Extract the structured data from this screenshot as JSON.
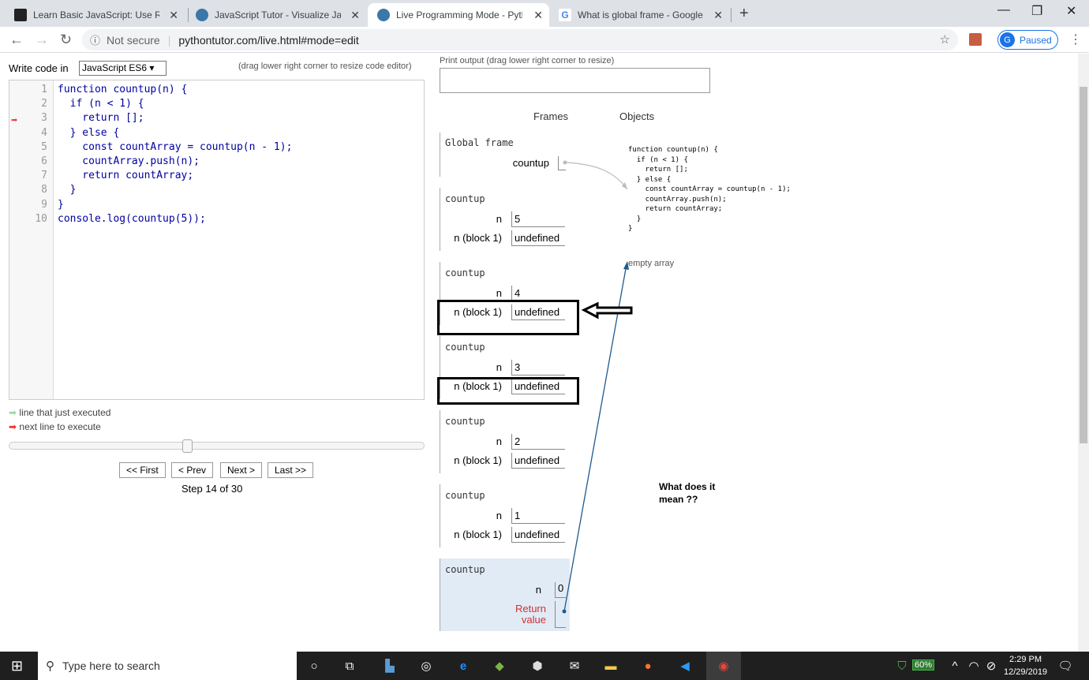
{
  "tabs": [
    {
      "title": "Learn Basic JavaScript: Use Recur",
      "active": false
    },
    {
      "title": "JavaScript Tutor - Visualize JavaS",
      "active": false
    },
    {
      "title": "Live Programming Mode - Pytho",
      "active": true
    },
    {
      "title": "What is global frame - Google Se",
      "active": false
    }
  ],
  "address": {
    "security": "Not secure",
    "url": "pythontutor.com/live.html#mode=edit"
  },
  "profile": {
    "initial": "G",
    "status": "Paused"
  },
  "editor": {
    "write_label": "Write code in",
    "language": "JavaScript ES6 ▾",
    "resize_hint": "(drag lower right corner to resize code editor)",
    "lines": [
      "function countup(n) {",
      "  if (n < 1) {",
      "    return [];",
      "  } else {",
      "    const countArray = countup(n - 1);",
      "    countArray.push(n);",
      "    return countArray;",
      "  }",
      "}",
      "console.log(countup(5));"
    ],
    "line_numbers": [
      "1",
      "2",
      "3",
      "4",
      "5",
      "6",
      "7",
      "8",
      "9",
      "10"
    ]
  },
  "legend": {
    "executed": "line that just executed",
    "next": "next line to execute"
  },
  "nav": {
    "first": "<< First",
    "prev": "< Prev",
    "next": "Next >",
    "last": "Last >>",
    "step": "Step 14 of 30"
  },
  "output": {
    "label": "Print output (drag lower right corner to resize)"
  },
  "viz": {
    "frames_header": "Frames",
    "objects_header": "Objects",
    "global": {
      "name": "Global frame",
      "var": "countup"
    },
    "frames": [
      {
        "name": "countup",
        "n": "5",
        "block_label": "n (block 1)",
        "block_value": "undefined"
      },
      {
        "name": "countup",
        "n": "4",
        "block_label": "n (block 1)",
        "block_value": "undefined"
      },
      {
        "name": "countup",
        "n": "3",
        "block_label": "n (block 1)",
        "block_value": "undefined"
      },
      {
        "name": "countup",
        "n": "2",
        "block_label": "n (block 1)",
        "block_value": "undefined"
      },
      {
        "name": "countup",
        "n": "1",
        "block_label": "n (block 1)",
        "block_value": "undefined"
      }
    ],
    "current_frame": {
      "name": "countup",
      "n_label": "n",
      "n": "0",
      "return_label_1": "Return",
      "return_label_2": "value"
    },
    "n_label": "n",
    "function_object": "function countup(n) {\n  if (n < 1) {\n    return [];\n  } else {\n    const countArray = countup(n - 1);\n    countArray.push(n);\n    return countArray;\n  }\n}",
    "empty_array": "empty array"
  },
  "annotation": {
    "line1": "What does it",
    "line2": "mean ??"
  },
  "taskbar": {
    "search_placeholder": "Type here to search",
    "battery": "60%",
    "time": "2:29 PM",
    "date": "12/29/2019"
  }
}
